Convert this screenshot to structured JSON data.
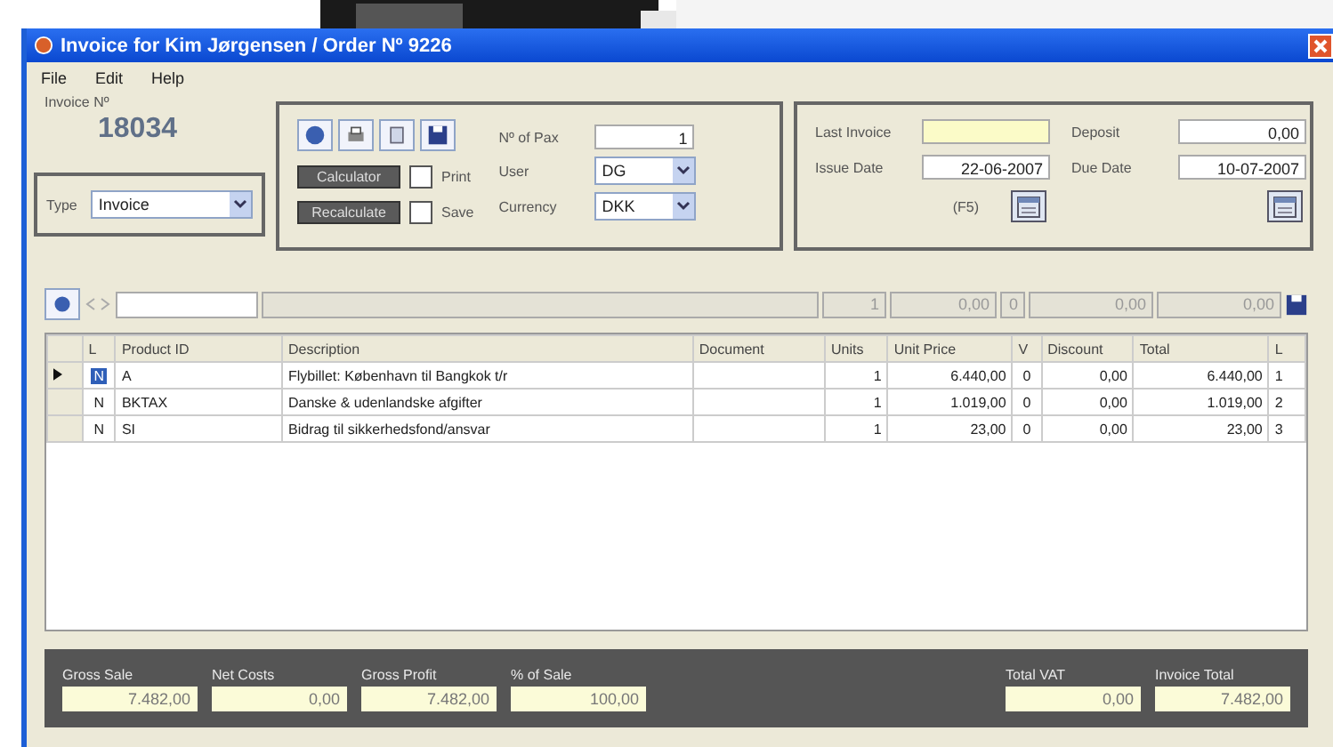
{
  "window": {
    "title": "Invoice for Kim Jørgensen / Order Nº 9226"
  },
  "menu": [
    "File",
    "Edit",
    "Help"
  ],
  "invoice": {
    "label": "Invoice Nº",
    "number": "18034",
    "type_label": "Type",
    "type_value": "Invoice"
  },
  "tools": {
    "buttons": [
      "Calculator",
      "Recalculate"
    ],
    "checkboxes": [
      {
        "label": "Print",
        "checked": false
      },
      {
        "label": "Save",
        "checked": false
      }
    ],
    "fields": [
      {
        "label": "Nº of Pax",
        "value": "1",
        "kind": "text"
      },
      {
        "label": "User",
        "value": "DG",
        "kind": "combo"
      },
      {
        "label": "Currency",
        "value": "DKK",
        "kind": "combo"
      }
    ]
  },
  "dates": {
    "fields": [
      {
        "label": "Last Invoice",
        "kind": "highlight"
      },
      {
        "label": "Deposit",
        "value": "0,00",
        "kind": "text"
      },
      {
        "label": "Issue Date",
        "value": "22-06-2007",
        "kind": "text"
      },
      {
        "label": "Due Date",
        "value": "10-07-2007",
        "kind": "text"
      }
    ],
    "hotkey": "(F5)"
  },
  "entry_bar": [
    "1",
    "0,00",
    "0",
    "0,00",
    "0,00"
  ],
  "table": {
    "columns": [
      "L",
      "Product ID",
      "Description",
      "Document",
      "Units",
      "Unit Price",
      "V",
      "Discount",
      "Total",
      "L"
    ],
    "rows": [
      {
        "selected": true,
        "cells": [
          "N",
          "A",
          "Flybillet: København til Bangkok t/r",
          "",
          "1",
          "6.440,00",
          "0",
          "0,00",
          "6.440,00",
          "1"
        ]
      },
      {
        "selected": false,
        "cells": [
          "N",
          "BKTAX",
          "Danske & udenlandske afgifter",
          "",
          "1",
          "1.019,00",
          "0",
          "0,00",
          "1.019,00",
          "2"
        ]
      },
      {
        "selected": false,
        "cells": [
          "N",
          "SI",
          "Bidrag til sikkerhedsfond/ansvar",
          "",
          "1",
          "23,00",
          "0",
          "0,00",
          "23,00",
          "3"
        ]
      }
    ]
  },
  "totals": [
    {
      "label": "Gross Sale",
      "value": "7.482,00"
    },
    {
      "label": "Net Costs",
      "value": "0,00"
    },
    {
      "label": "Gross Profit",
      "value": "7.482,00"
    },
    {
      "label": "% of Sale",
      "value": "100,00"
    },
    {
      "label": "Total VAT",
      "value": "0,00",
      "kind": "right"
    },
    {
      "label": "Invoice Total",
      "value": "7.482,00",
      "kind": "right"
    }
  ]
}
